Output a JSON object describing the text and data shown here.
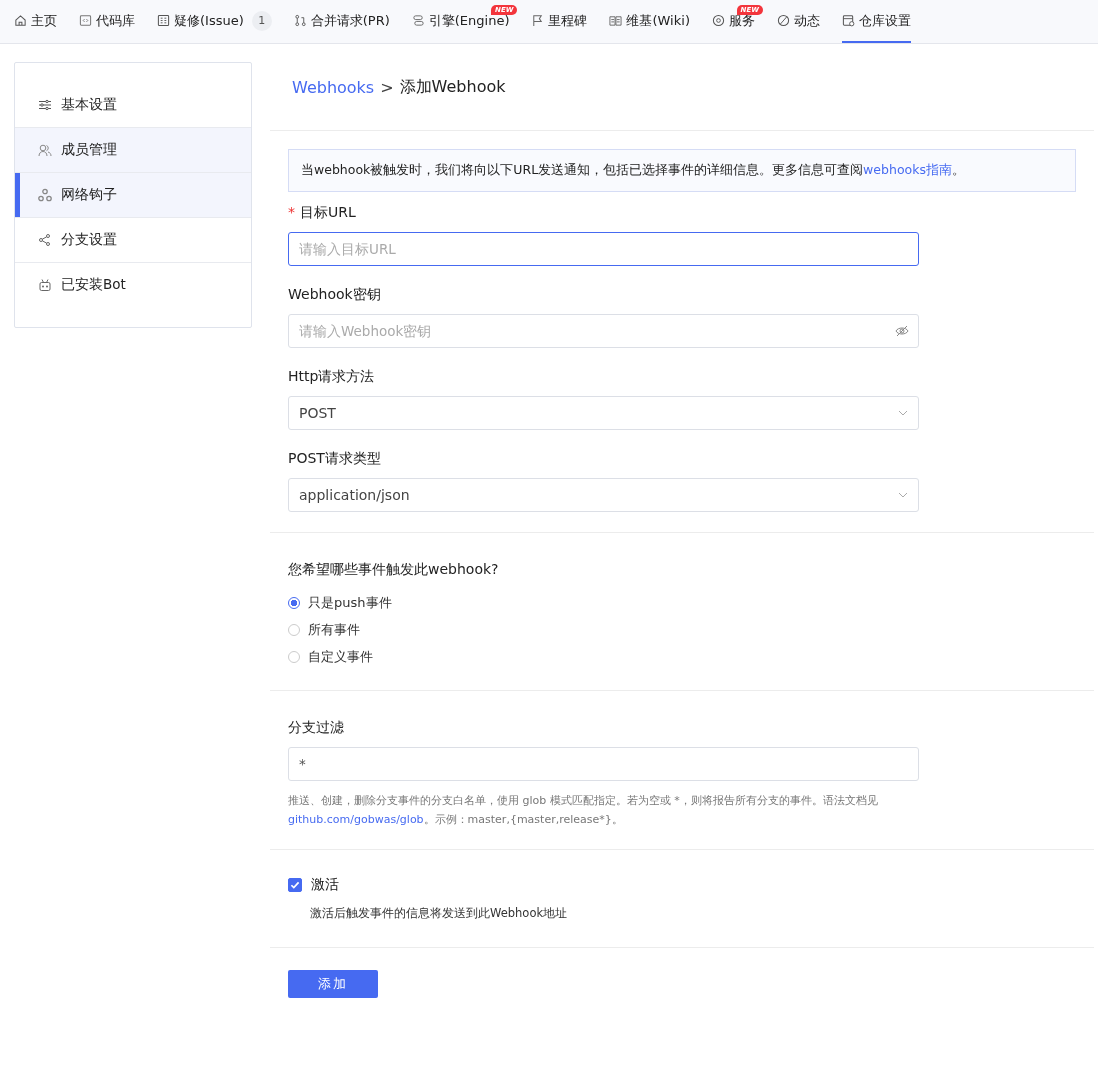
{
  "tabs": [
    {
      "label": "主页",
      "selected": false
    },
    {
      "label": "代码库",
      "selected": false
    },
    {
      "label": "疑修(Issue)",
      "selected": false,
      "count": "1"
    },
    {
      "label": "合并请求(PR)",
      "selected": false
    },
    {
      "label": "引擎(Engine)",
      "selected": false,
      "badge": "NEW"
    },
    {
      "label": "里程碑",
      "selected": false
    },
    {
      "label": "维基(Wiki)",
      "selected": false
    },
    {
      "label": "服务",
      "selected": false,
      "badge": "NEW"
    },
    {
      "label": "动态",
      "selected": false
    },
    {
      "label": "仓库设置",
      "selected": true
    }
  ],
  "sidebar": {
    "items": [
      {
        "label": "基本设置",
        "selected": false,
        "hovered": false
      },
      {
        "label": "成员管理",
        "selected": false,
        "hovered": true
      },
      {
        "label": "网络钩子",
        "selected": true,
        "hovered": false
      },
      {
        "label": "分支设置",
        "selected": false,
        "hovered": false
      },
      {
        "label": "已安装Bot",
        "selected": false,
        "hovered": false
      }
    ]
  },
  "breadcrumb": {
    "link": "Webhooks",
    "separator": ">",
    "current": "添加Webhook"
  },
  "notice": {
    "text": "当webhook被触发时，我们将向以下URL发送通知，包括已选择事件的详细信息。更多信息可查阅",
    "link": "webhooks指南",
    "end": "。"
  },
  "fields": [
    {
      "kind": "text",
      "label": "目标URL",
      "required": true,
      "placeholder": "请输入目标URL",
      "focused": true
    },
    {
      "kind": "password",
      "label": "Webhook密钥",
      "required": false,
      "placeholder": "请输入Webhook密钥",
      "focused": false
    },
    {
      "kind": "select",
      "label": "Http请求方法",
      "required": false,
      "value": "POST",
      "focused": false
    },
    {
      "kind": "select",
      "label": "POST请求类型",
      "required": false,
      "value": "application/json",
      "focused": false
    }
  ],
  "events": {
    "question": "您希望哪些事件触发此webhook?",
    "options": [
      {
        "label": "只是push事件",
        "selected": true
      },
      {
        "label": "所有事件",
        "selected": false
      },
      {
        "label": "自定义事件",
        "selected": false
      }
    ]
  },
  "branch_filter": {
    "label": "分支过滤",
    "value": "*",
    "help": "推送、创建，删除分支事件的分支白名单，使用 glob 模式匹配指定。若为空或 *，则将报告所有分支的事件。语法文档见",
    "help_link": "github.com/gobwas/glob",
    "help_end": "。示例：master,{master,release*}。"
  },
  "active": {
    "label": "激活",
    "checked": true,
    "description": "激活后触发事件的信息将发送到此Webhook地址"
  },
  "submit": "添加"
}
